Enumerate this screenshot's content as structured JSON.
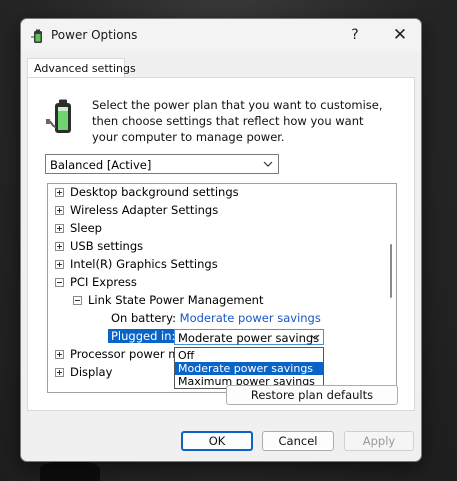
{
  "window": {
    "title": "Power Options",
    "help_label": "?",
    "close_label": "✕"
  },
  "tabs": [
    {
      "label": "Advanced settings"
    }
  ],
  "description": "Select the power plan that you want to customise, then choose settings that reflect how you want your computer to manage power.",
  "plan_select": {
    "value": "Balanced [Active]"
  },
  "settings_tree": {
    "items": [
      {
        "label": "Desktop background settings",
        "expanded": false
      },
      {
        "label": "Wireless Adapter Settings",
        "expanded": false
      },
      {
        "label": "Sleep",
        "expanded": false
      },
      {
        "label": "USB settings",
        "expanded": false
      },
      {
        "label": "Intel(R) Graphics Settings",
        "expanded": false
      },
      {
        "label": "PCI Express",
        "expanded": true
      },
      {
        "label": "Link State Power Management",
        "expanded": true
      },
      {
        "label": "Processor power management",
        "expanded": false
      },
      {
        "label": "Display",
        "expanded": false
      }
    ],
    "on_battery": {
      "label": "On battery:",
      "value": "Moderate power savings"
    },
    "plugged_in": {
      "label": "Plugged in:",
      "value": "Moderate power savings",
      "options": [
        "Off",
        "Moderate power savings",
        "Maximum power savings"
      ],
      "selected_option": "Moderate power savings"
    }
  },
  "buttons": {
    "restore": "Restore plan defaults",
    "ok": "OK",
    "cancel": "Cancel",
    "apply": "Apply"
  },
  "colors": {
    "accent": "#0a64c8",
    "link": "#1a55c9"
  },
  "icons": {
    "app": "power-options-icon",
    "plan": "battery-plug-icon",
    "dropdown": "chevron-down-icon"
  }
}
